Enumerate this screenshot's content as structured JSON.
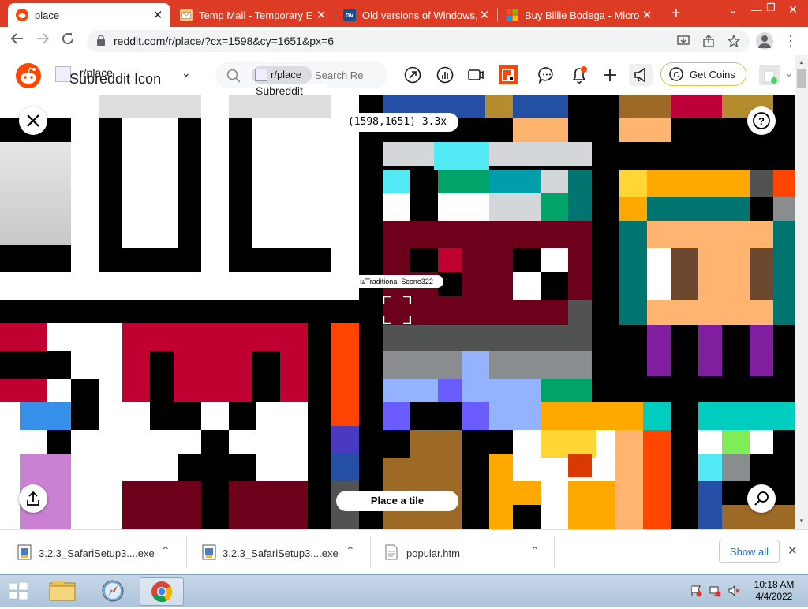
{
  "browser": {
    "tabs": [
      {
        "title": "place",
        "active": true,
        "favicon": "reddit-icon"
      },
      {
        "title": "Temp Mail - Temporary Email",
        "active": false,
        "favicon": "envelope-icon"
      },
      {
        "title": "Old versions of Windows, Mac",
        "active": false,
        "favicon": "ov-icon",
        "favicon_text": "ov"
      },
      {
        "title": "Buy Billie Bodega - Microsoft Store",
        "active": false,
        "favicon": "microsoft-icon"
      }
    ],
    "new_tab": "+",
    "url": "reddit.com/r/place/?cx=1598&cy=1651&px=6"
  },
  "reddit": {
    "community": "r/place",
    "subreddit_icon_alt": "Subreddit Icon",
    "search_chip": "r/place",
    "search_chip_alt": "Subreddit Icon",
    "search_placeholder": "Search Re",
    "get_coins": "Get Coins"
  },
  "place": {
    "coordinates": "(1598,1651) 3.3x",
    "username": "u/Traditional-Scene322",
    "place_tile": "Place a tile"
  },
  "downloads": {
    "items": [
      {
        "name": "3.2.3_SafariSetup3....exe",
        "icon": "exe-file-icon"
      },
      {
        "name": "3.2.3_SafariSetup3....exe",
        "icon": "exe-file-icon"
      },
      {
        "name": "popular.htm",
        "icon": "html-file-icon"
      }
    ],
    "show_all": "Show all"
  },
  "taskbar": {
    "time": "10:18 AM",
    "date": "4/4/2022"
  },
  "colors": {
    "reddit_orange": "#ff4500",
    "tab_strip": "#de3b24",
    "notification": "#ff4500"
  }
}
